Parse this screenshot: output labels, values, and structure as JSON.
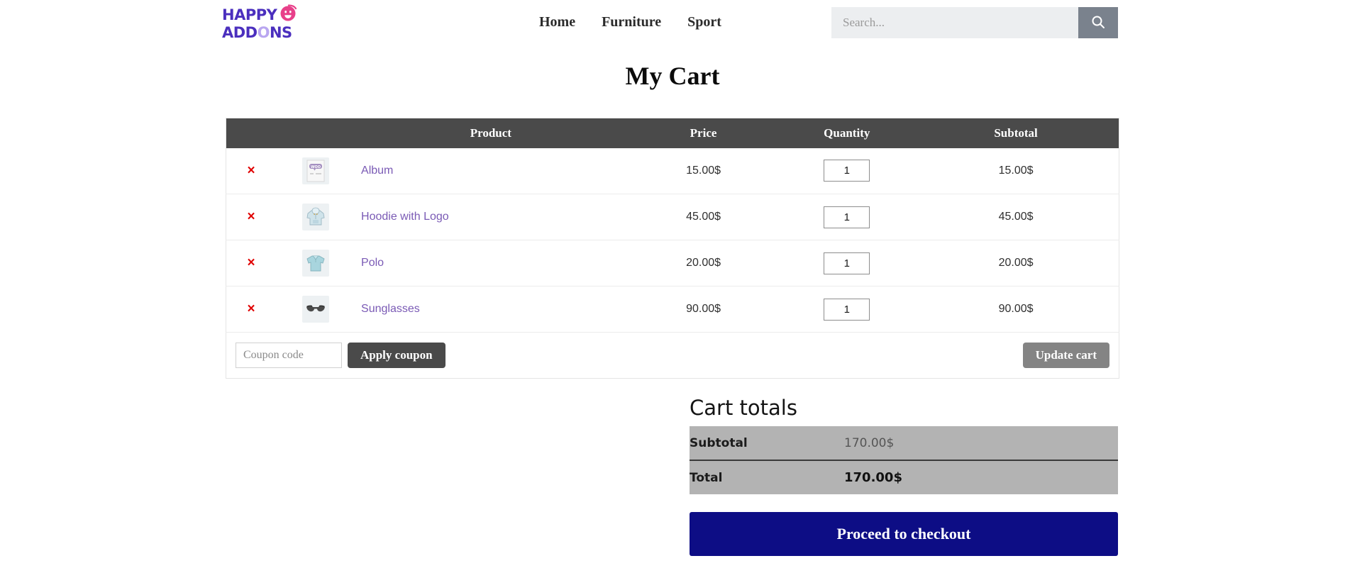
{
  "header": {
    "logo": {
      "line1": "HAPPY",
      "line2": "ADD",
      "line2_o": "O",
      "line2_end": "NS",
      "face_icon": "smiley-face-icon"
    },
    "nav": [
      {
        "label": "Home",
        "name": "nav-home"
      },
      {
        "label": "Furniture",
        "name": "nav-furniture"
      },
      {
        "label": "Sport",
        "name": "nav-sport"
      }
    ],
    "search": {
      "value": "",
      "placeholder": "Search...",
      "button_icon": "search-icon"
    }
  },
  "page": {
    "title": "My Cart"
  },
  "cart": {
    "columns": {
      "remove": "",
      "thumbnail": "",
      "product": "Product",
      "price": "Price",
      "quantity": "Quantity",
      "subtotal": "Subtotal"
    },
    "remove_label": "×",
    "items": [
      {
        "name": "Album",
        "price": "15.00$",
        "quantity": "1",
        "subtotal": "15.00$",
        "thumb_icon": "woo-placeholder-icon"
      },
      {
        "name": "Hoodie with Logo",
        "price": "45.00$",
        "quantity": "1",
        "subtotal": "45.00$",
        "thumb_icon": "hoodie-icon"
      },
      {
        "name": "Polo",
        "price": "20.00$",
        "quantity": "1",
        "subtotal": "20.00$",
        "thumb_icon": "polo-shirt-icon"
      },
      {
        "name": "Sunglasses",
        "price": "90.00$",
        "quantity": "1",
        "subtotal": "90.00$",
        "thumb_icon": "sunglasses-icon"
      }
    ],
    "coupon": {
      "value": "",
      "placeholder": "Coupon code",
      "apply_label": "Apply coupon",
      "update_label": "Update cart"
    }
  },
  "totals": {
    "heading": "Cart totals",
    "subtotal_label": "Subtotal",
    "subtotal_value": "170.00$",
    "total_label": "Total",
    "total_value": "170.00$",
    "checkout_label": "Proceed to checkout"
  },
  "colors": {
    "brand_purple": "#4b2fbe",
    "brand_pink": "#e8408a",
    "product_link": "#7a5ab5",
    "table_header_bg": "#4a4a4a",
    "remove_red": "#e00000",
    "totals_bg": "#b3b3b3",
    "checkout_navy": "#0d0d85",
    "search_btn_gray": "#7a828d"
  }
}
